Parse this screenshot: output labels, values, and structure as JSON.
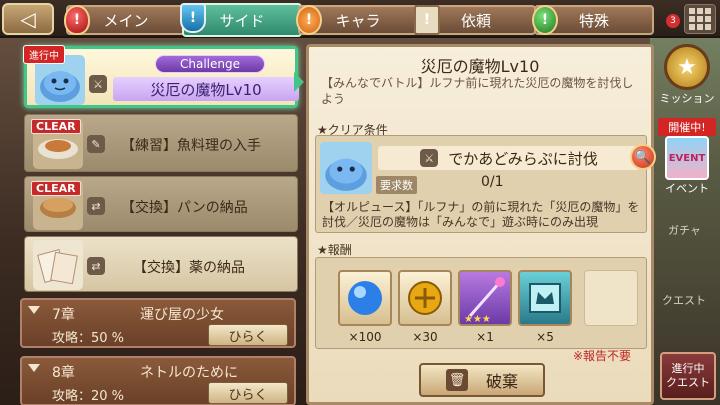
{
  "tabs": [
    {
      "label": "メイン",
      "icon": "exclamation-icon",
      "glyph": "!"
    },
    {
      "label": "サイド",
      "icon": "shield-icon",
      "glyph": "!"
    },
    {
      "label": "キャラ",
      "icon": "heart-icon",
      "glyph": "!"
    },
    {
      "label": "依頼",
      "icon": "scroll-icon",
      "glyph": "!"
    },
    {
      "label": "特殊",
      "icon": "gem-icon",
      "glyph": "!"
    }
  ],
  "header": {
    "badge_count": "3"
  },
  "quests": [
    {
      "status": "進行中",
      "challenge": "Challenge",
      "title": "災厄の魔物Lv10"
    },
    {
      "clear": "CLEAR",
      "title": "【練習】魚料理の入手"
    },
    {
      "clear": "CLEAR",
      "title": "【交換】パンの納品"
    },
    {
      "title": "【交換】薬の納品"
    }
  ],
  "chapters": [
    {
      "num": "7章",
      "name": "運び屋の少女",
      "progress": "攻略：50 %",
      "open": "ひらく"
    },
    {
      "num": "8章",
      "name": "ネトルのために",
      "progress": "攻略：20 %",
      "open": "ひらく"
    }
  ],
  "detail": {
    "title": "災厄の魔物Lv10",
    "desc": "【みんなでバトル】ルフナ前に現れた災厄の魔物を討伐しよう",
    "cond_label": "クリア条件",
    "cond_text": "でかあどみらぷに討伐",
    "req_label": "要求数",
    "req_value": "0/1",
    "cond_note": "【オルピュース】「ルフナ」の前に現れた「災厄の魔物」を討伐／災厄の魔物は「みんなで」遊ぶ時にのみ出現",
    "reward_label": "報酬",
    "rewards": [
      "×100",
      "×30",
      "×1",
      "×5"
    ],
    "report_note": "※報告不要",
    "discard_label": "破棄"
  },
  "side": {
    "mission": "ミッション",
    "event_tag": "開催中!",
    "event_icon": "EVENT",
    "event": "イベント",
    "gacha": "ガチャ",
    "quest": "クエスト",
    "progress_quest": "進行中\nクエスト"
  },
  "colors": {
    "accent": "#45c48a",
    "clear_red": "#c62929",
    "challenge": "#8a52c8"
  }
}
